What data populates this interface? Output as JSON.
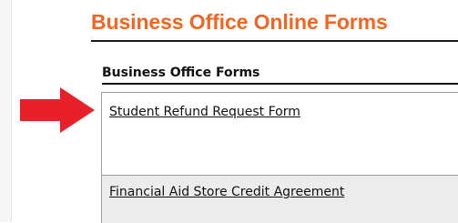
{
  "page": {
    "title": "Business Office Online Forms",
    "title_color": "#f26522"
  },
  "forms_section": {
    "heading": "Business Office Forms",
    "items": [
      {
        "label": "Student Refund Request Form"
      },
      {
        "label": "Financial Aid Store Credit Agreement"
      }
    ]
  },
  "annotation": {
    "arrow_icon": "red-arrow-right-icon",
    "arrow_color": "#e8202a"
  }
}
